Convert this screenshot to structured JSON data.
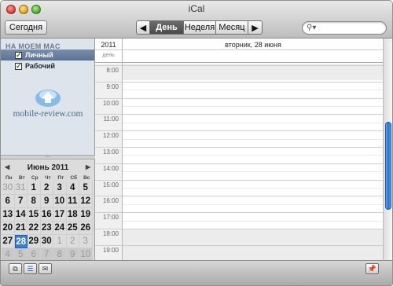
{
  "window": {
    "title": "iCal"
  },
  "toolbar": {
    "today_label": "Сегодня",
    "prev_icon": "chevron-left-icon",
    "next_icon": "chevron-right-icon",
    "views": [
      {
        "label": "День",
        "active": true
      },
      {
        "label": "Неделя",
        "active": false
      },
      {
        "label": "Месяц",
        "active": false
      }
    ],
    "search": {
      "placeholder": "",
      "value": ""
    }
  },
  "sidebar": {
    "header": "НА МОЕМ MAC",
    "calendars": [
      {
        "label": "Личный",
        "checked": true,
        "selected": true
      },
      {
        "label": "Рабочий",
        "checked": true,
        "selected": false
      }
    ]
  },
  "watermark": {
    "text": "mobile-review.com"
  },
  "mini_calendar": {
    "month_label": "Июнь 2011",
    "weekdays": [
      "Пн",
      "Вт",
      "Ср",
      "Чт",
      "Пт",
      "Сб",
      "Вс"
    ],
    "weeks": [
      [
        {
          "d": "30",
          "muted": true
        },
        {
          "d": "31",
          "muted": true
        },
        {
          "d": "1"
        },
        {
          "d": "2"
        },
        {
          "d": "3"
        },
        {
          "d": "4"
        },
        {
          "d": "5"
        }
      ],
      [
        {
          "d": "6"
        },
        {
          "d": "7"
        },
        {
          "d": "8"
        },
        {
          "d": "9"
        },
        {
          "d": "10"
        },
        {
          "d": "11"
        },
        {
          "d": "12"
        }
      ],
      [
        {
          "d": "13"
        },
        {
          "d": "14"
        },
        {
          "d": "15"
        },
        {
          "d": "16"
        },
        {
          "d": "17"
        },
        {
          "d": "18"
        },
        {
          "d": "19"
        }
      ],
      [
        {
          "d": "20"
        },
        {
          "d": "21"
        },
        {
          "d": "22"
        },
        {
          "d": "23"
        },
        {
          "d": "24"
        },
        {
          "d": "25"
        },
        {
          "d": "26"
        }
      ],
      [
        {
          "d": "27"
        },
        {
          "d": "28",
          "today": true
        },
        {
          "d": "29"
        },
        {
          "d": "30"
        },
        {
          "d": "1",
          "muted": true
        },
        {
          "d": "2",
          "muted": true
        },
        {
          "d": "3",
          "muted": true
        }
      ],
      [
        {
          "d": "4",
          "muted": true
        },
        {
          "d": "5",
          "muted": true
        },
        {
          "d": "6",
          "muted": true
        },
        {
          "d": "7",
          "muted": true
        },
        {
          "d": "8",
          "muted": true
        },
        {
          "d": "9",
          "muted": true
        },
        {
          "d": "10",
          "muted": true
        }
      ]
    ],
    "today_color": "#3a7fd5"
  },
  "day_view": {
    "year": "2011",
    "date_label": "вторник, 28 июня",
    "allday_label": "день",
    "hours": [
      "8:00",
      "9:00",
      "10:00",
      "11:00",
      "12:00",
      "13:00",
      "14:00",
      "15:00",
      "16:00",
      "17:00",
      "18:00",
      "19:00"
    ]
  },
  "bottom_bar": {
    "left_buttons": [
      "calendars-icon",
      "day-list-icon",
      "mail-icon"
    ],
    "right_button": "pushpin-icon"
  }
}
